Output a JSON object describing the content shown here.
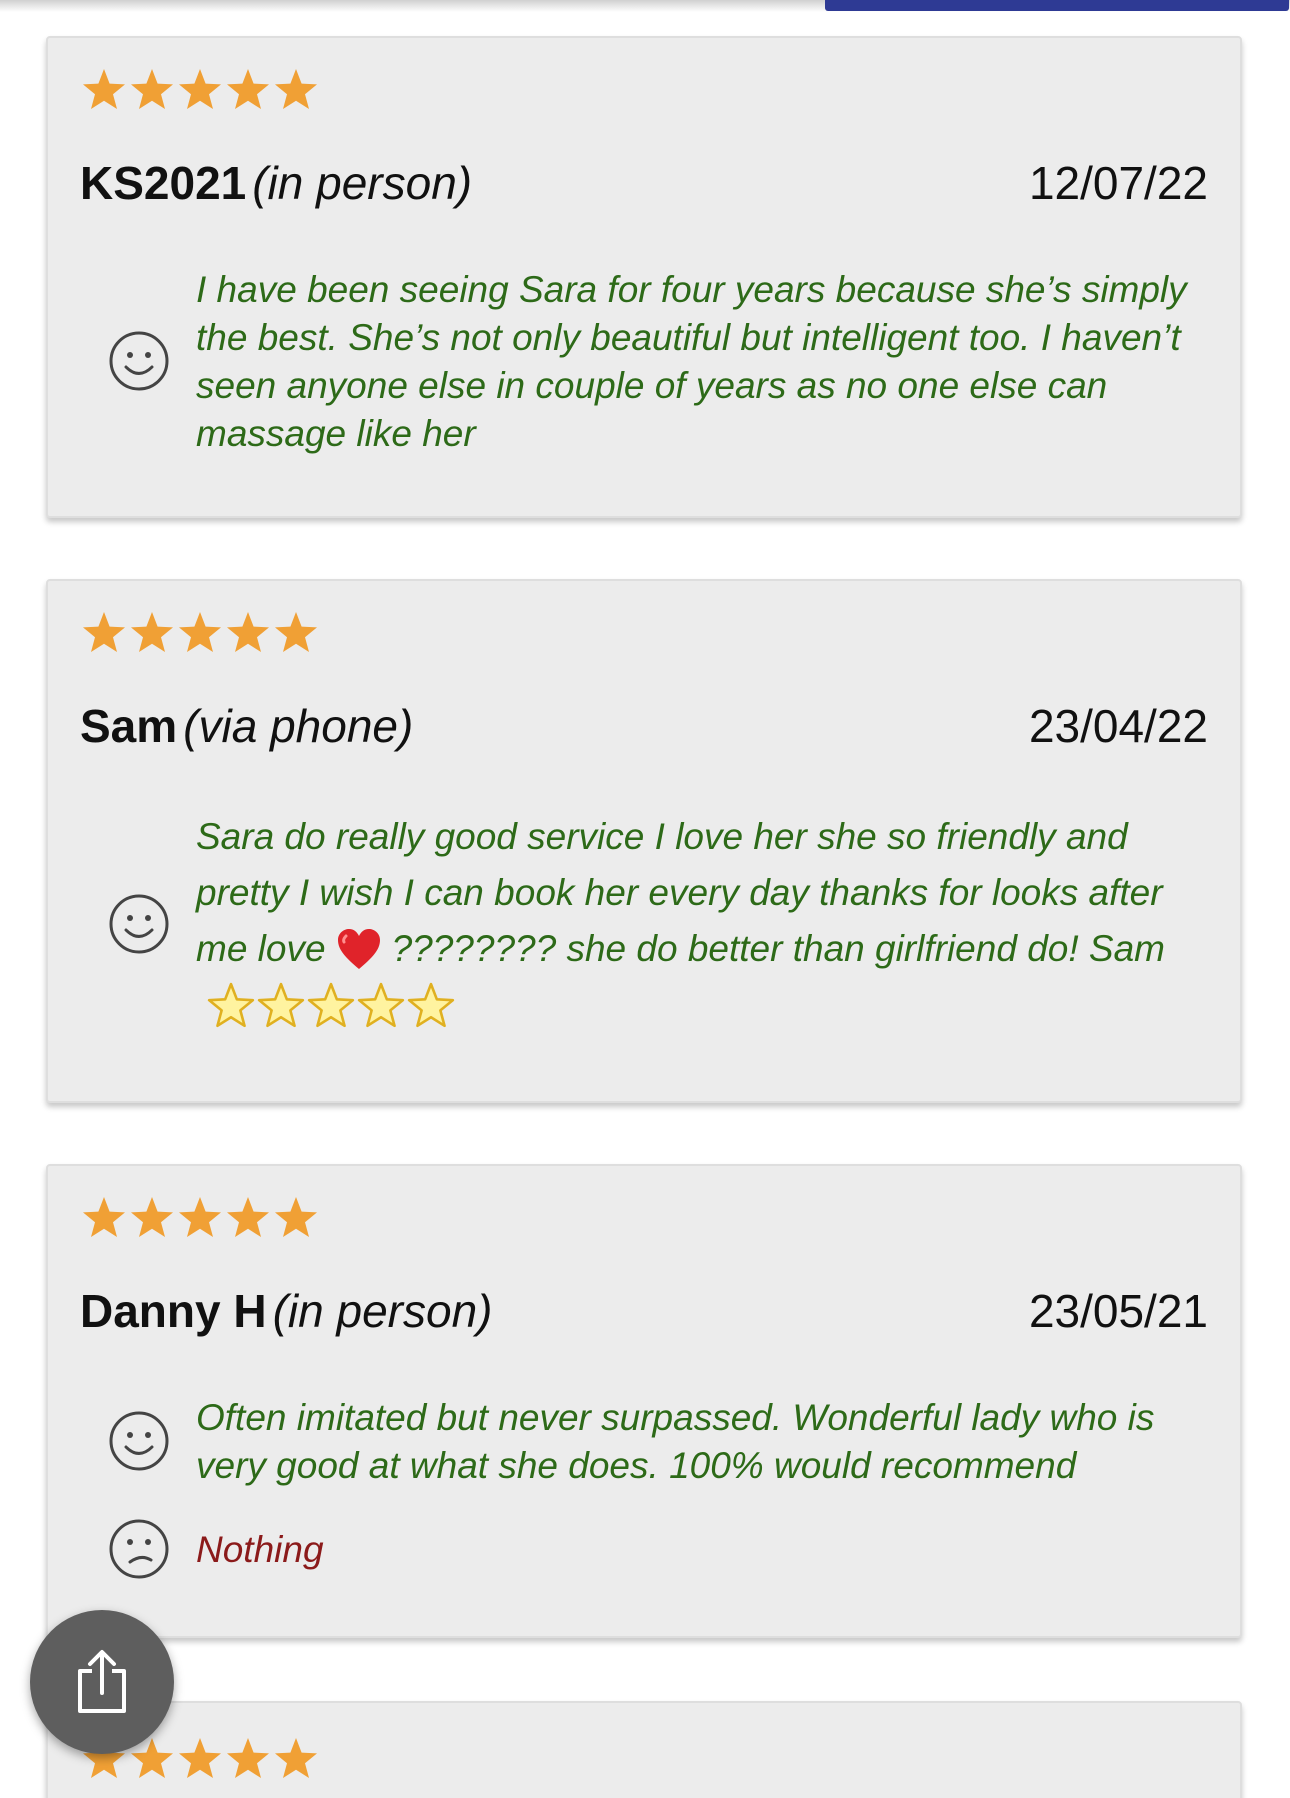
{
  "top_bar": {
    "progress_fraction": 0.36,
    "progress_color": "#2e3a94"
  },
  "colors": {
    "star": "#f0a035",
    "positive_text": "#2d6a18",
    "negative_text": "#8b1a1a",
    "card_bg": "#ececec"
  },
  "reviews": [
    {
      "rating": 5,
      "reviewer": "KS2021",
      "method": "(in person)",
      "date": "12/07/22",
      "positive_icon": "smiley-face-icon",
      "positive": "I have been seeing Sara for four years because she’s simply the best. She’s not only beautiful but intelligent too. I haven’t seen anyone else in couple of years as no one else can massage like her"
    },
    {
      "rating": 5,
      "reviewer": "Sam",
      "method": "(via phone)",
      "date": "23/04/22",
      "positive_icon": "smiley-face-icon",
      "positive_part1": "Sara do really good service I love her she so friendly and pretty I wish I can book her every day thanks for looks after me love",
      "positive_heart_icon": "red-heart-emoji-icon",
      "positive_part2": "???????? she do better than girlfriend do! Sam",
      "positive_trailing_stars": 5
    },
    {
      "rating": 5,
      "reviewer": "Danny H",
      "method": "(in person)",
      "date": "23/05/21",
      "positive_icon": "smiley-face-icon",
      "positive": "Often imitated but never surpassed. Wonderful lady who is very good at what she does. 100% would recommend",
      "negative_icon": "sad-face-icon",
      "negative": "Nothing"
    },
    {
      "rating": 5
    }
  ],
  "share_button": {
    "icon": "share-icon"
  }
}
